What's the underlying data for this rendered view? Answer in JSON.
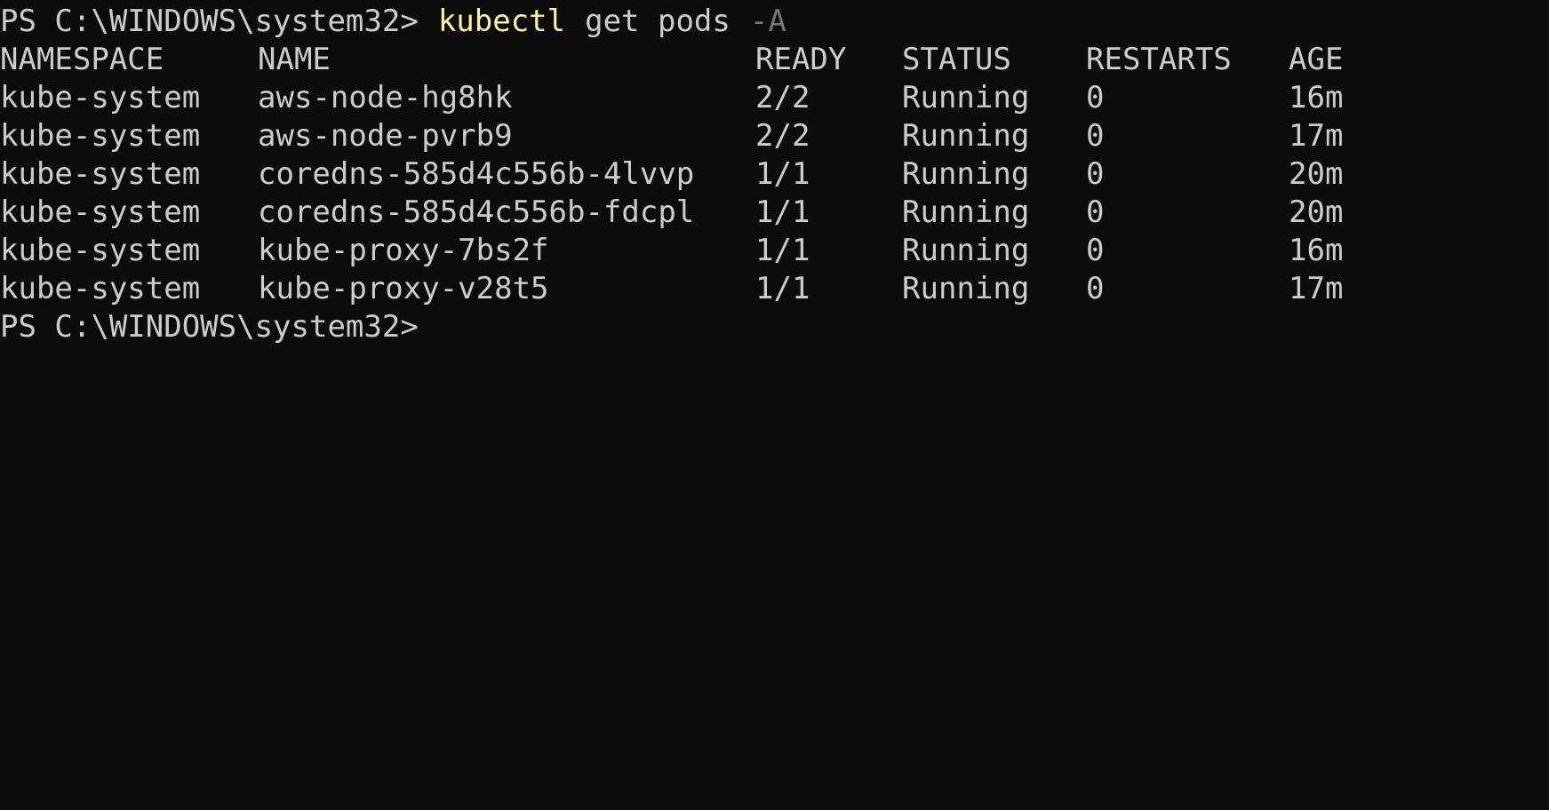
{
  "command_line": {
    "prompt": "PS C:\\WINDOWS\\system32>",
    "command": "kubectl",
    "args": "get pods",
    "flag": "-A"
  },
  "table": {
    "headers": [
      "NAMESPACE",
      "NAME",
      "READY",
      "STATUS",
      "RESTARTS",
      "AGE"
    ],
    "rows": [
      [
        "kube-system",
        "aws-node-hg8hk",
        "2/2",
        "Running",
        "0",
        "16m"
      ],
      [
        "kube-system",
        "aws-node-pvrb9",
        "2/2",
        "Running",
        "0",
        "17m"
      ],
      [
        "kube-system",
        "coredns-585d4c556b-4lvvp",
        "1/1",
        "Running",
        "0",
        "20m"
      ],
      [
        "kube-system",
        "coredns-585d4c556b-fdcpl",
        "1/1",
        "Running",
        "0",
        "20m"
      ],
      [
        "kube-system",
        "kube-proxy-7bs2f",
        "1/1",
        "Running",
        "0",
        "16m"
      ],
      [
        "kube-system",
        "kube-proxy-v28t5",
        "1/1",
        "Running",
        "0",
        "17m"
      ]
    ]
  },
  "final_prompt": "PS C:\\WINDOWS\\system32>",
  "colors": {
    "background": "#0c0c0c",
    "text": "#cccccc",
    "command": "#f9f1a5",
    "flag": "#767676"
  }
}
